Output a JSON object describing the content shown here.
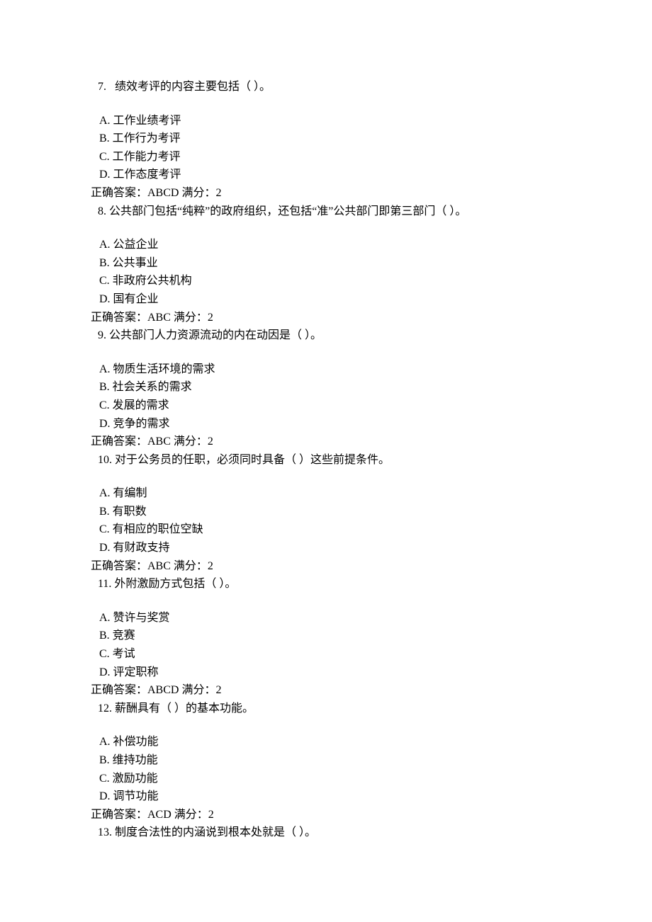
{
  "questions": [
    {
      "number": "7.",
      "stem": "绩效考评的内容主要包括（          ）。",
      "options": {
        "A": "A.  工作业绩考评",
        "B": "B.  工作行为考评",
        "C": "C.  工作能力考评",
        "D": "D.  工作态度考评"
      },
      "answer": "正确答案：ABCD    满分：2",
      "followup": "8.    公共部门包括“纯粹”的政府组织，还包括“准”公共部门即第三部门（       ）。"
    },
    {
      "options": {
        "A": "A.  公益企业",
        "B": "B.  公共事业",
        "C": "C.  非政府公共机构",
        "D": "D.  国有企业"
      },
      "answer": "正确答案：ABC    满分：2",
      "followup": "9.    公共部门人力资源流动的内在动因是（          ）。"
    },
    {
      "options": {
        "A": "A.  物质生活环境的需求",
        "B": "B.  社会关系的需求",
        "C": "C.  发展的需求",
        "D": "D.  竞争的需求"
      },
      "answer": "正确答案：ABC    满分：2",
      "followup": "10.    对于公务员的任职，必须同时具备（          ）这些前提条件。"
    },
    {
      "options": {
        "A": "A.  有编制",
        "B": "B.  有职数",
        "C": "C.  有相应的职位空缺",
        "D": "D.  有财政支持"
      },
      "answer": "正确答案：ABC    满分：2",
      "followup": "11.    外附激励方式包括（          ）。"
    },
    {
      "options": {
        "A": "A.  赞许与奖赏",
        "B": "B.  竞赛",
        "C": "C.  考试",
        "D": "D.  评定职称"
      },
      "answer": "正确答案：ABCD    满分：2",
      "followup": "12.    薪酬具有（          ）的基本功能。"
    },
    {
      "options": {
        "A": "A.  补偿功能",
        "B": "B.  维持功能",
        "C": "C.  激励功能",
        "D": "D.  调节功能"
      },
      "answer": "正确答案：ACD    满分：2",
      "followup": "13.    制度合法性的内涵说到根本处就是（          ）。"
    }
  ]
}
